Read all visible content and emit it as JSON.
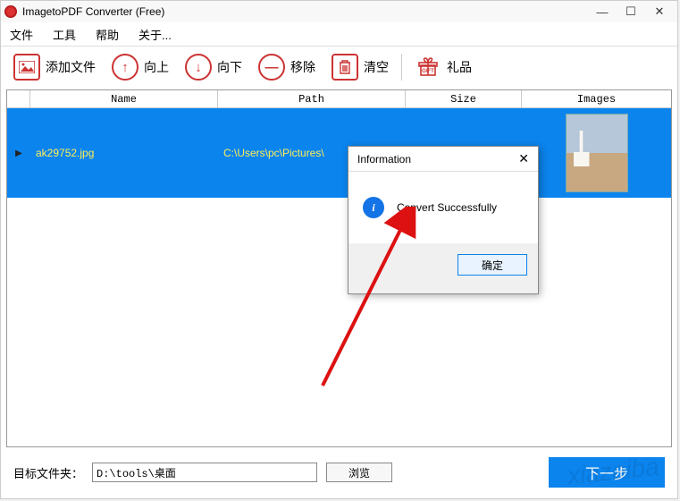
{
  "titlebar": {
    "title": "ImagetoPDF Converter (Free)"
  },
  "menu": {
    "file": "文件",
    "tools": "工具",
    "help": "帮助",
    "about": "关于..."
  },
  "toolbar": {
    "add": "添加文件",
    "up": "向上",
    "down": "向下",
    "remove": "移除",
    "clear": "清空",
    "gift": "礼品"
  },
  "columns": {
    "name": "Name",
    "path": "Path",
    "size": "Size",
    "images": "Images"
  },
  "row": {
    "marker": "▶",
    "name": "ak29752.jpg",
    "path": "C:\\Users\\pc\\Pictures\\"
  },
  "dialog": {
    "title": "Information",
    "message": "Convert Successfully",
    "ok": "确定"
  },
  "footer": {
    "label": "目标文件夹：",
    "path": "D:\\tools\\桌面",
    "browse": "浏览",
    "next": "下一步"
  },
  "watermark": "xiazaiba"
}
